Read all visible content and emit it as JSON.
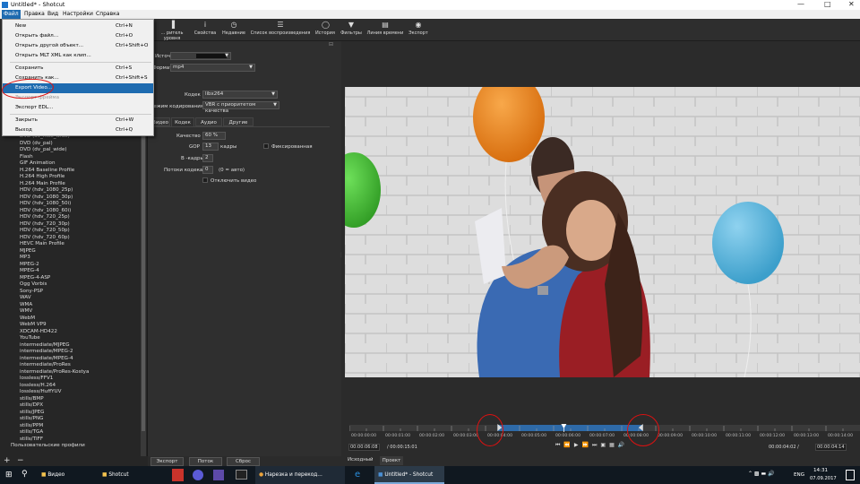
{
  "window": {
    "title": "Untitled* - Shotcut"
  },
  "menubar": [
    "Файл",
    "Правка",
    "Вид",
    "Настройки",
    "Справка"
  ],
  "toolbar": [
    {
      "label": "... ритель уровня",
      "icon": "meter-icon"
    },
    {
      "label": "Свойства",
      "icon": "info-icon"
    },
    {
      "label": "Недавние",
      "icon": "clock-icon"
    },
    {
      "label": "Список воспроизведения",
      "icon": "list-icon"
    },
    {
      "label": "История",
      "icon": "history-icon"
    },
    {
      "label": "Фильтры",
      "icon": "filter-icon"
    },
    {
      "label": "Линия времени",
      "icon": "timeline-icon"
    },
    {
      "label": "Экспорт",
      "icon": "export-icon"
    }
  ],
  "file_menu": {
    "items": [
      {
        "label": "New",
        "shortcut": "Ctrl+N"
      },
      {
        "label": "Открыть файл...",
        "shortcut": "Ctrl+O"
      },
      {
        "label": "Открыть другой объект...",
        "shortcut": "Ctrl+Shift+O"
      },
      {
        "label": "Открыть MLT XML как клип...",
        "shortcut": ""
      },
      {
        "label": "Сохранить",
        "shortcut": "Ctrl+S"
      },
      {
        "label": "Сохранить как...",
        "shortcut": "Ctrl+Shift+S"
      },
      {
        "label": "Export Video...",
        "shortcut": ""
      },
      {
        "label": "Экспорт фрейма",
        "shortcut": ""
      },
      {
        "label": "Экспорт EDL...",
        "shortcut": ""
      },
      {
        "label": "Закрыть",
        "shortcut": "Ctrl+W"
      },
      {
        "label": "Выход",
        "shortcut": "Ctrl+Q"
      }
    ]
  },
  "export": {
    "source_label": "Источник",
    "format_label": "Формат",
    "format_value": "mp4",
    "tabs": [
      "Видео",
      "Кодек",
      "Аудио",
      "Другие"
    ],
    "codec_label": "Кодек",
    "codec_value": "libx264",
    "ratecontrol_label": "Режим кодирования",
    "ratecontrol_value": "VBR с приоритетом качества",
    "quality_label": "Качество",
    "quality_value": "60 %",
    "gop_label": "GOP",
    "gop_value": "13",
    "gop_unit": "кадры",
    "fixed_label": "Фиксированная",
    "bframes_label": "B -кадры",
    "bframes_value": "2",
    "threads_label": "Потоки кодека",
    "threads_value": "0",
    "threads_hint": "(0 = авто)",
    "disable_video_label": "Отключить видео",
    "buttons": [
      "Экспорт",
      "Поток",
      "Сброс"
    ]
  },
  "presets": [
    {
      "label": "DVD (dv_ntsc_wide)",
      "indent": true
    },
    {
      "label": "DVD (dv_pal)",
      "indent": true
    },
    {
      "label": "DVD (dv_pal_wide)",
      "indent": true
    },
    {
      "label": "Flash",
      "indent": true
    },
    {
      "label": "GIF Animation",
      "indent": true
    },
    {
      "label": "H.264 Baseline Profile",
      "indent": true
    },
    {
      "label": "H.264 High Profile",
      "indent": true
    },
    {
      "label": "H.264 Main Profile",
      "indent": true
    },
    {
      "label": "HDV (hdv_1080_25p)",
      "indent": true
    },
    {
      "label": "HDV (hdv_1080_30p)",
      "indent": true
    },
    {
      "label": "HDV (hdv_1080_50i)",
      "indent": true
    },
    {
      "label": "HDV (hdv_1080_60i)",
      "indent": true
    },
    {
      "label": "HDV (hdv_720_25p)",
      "indent": true
    },
    {
      "label": "HDV (hdv_720_30p)",
      "indent": true
    },
    {
      "label": "HDV (hdv_720_50p)",
      "indent": true
    },
    {
      "label": "HDV (hdv_720_60p)",
      "indent": true
    },
    {
      "label": "HEVC Main Profile",
      "indent": true
    },
    {
      "label": "MJPEG",
      "indent": true
    },
    {
      "label": "MP3",
      "indent": true
    },
    {
      "label": "MPEG-2",
      "indent": true
    },
    {
      "label": "MPEG-4",
      "indent": true
    },
    {
      "label": "MPEG-4-ASP",
      "indent": true
    },
    {
      "label": "Ogg Vorbis",
      "indent": true
    },
    {
      "label": "Sony-PSP",
      "indent": true
    },
    {
      "label": "WAV",
      "indent": true
    },
    {
      "label": "WMA",
      "indent": true
    },
    {
      "label": "WMV",
      "indent": true
    },
    {
      "label": "WebM",
      "indent": true
    },
    {
      "label": "WebM VP9",
      "indent": true
    },
    {
      "label": "XDCAM-HD422",
      "indent": true
    },
    {
      "label": "YouTube",
      "indent": true
    },
    {
      "label": "intermediate/MJPEG",
      "indent": true
    },
    {
      "label": "intermediate/MPEG-2",
      "indent": true
    },
    {
      "label": "intermediate/MPEG-4",
      "indent": true
    },
    {
      "label": "intermediate/ProRes",
      "indent": true
    },
    {
      "label": "intermediate/ProRes-Kostya",
      "indent": true
    },
    {
      "label": "lossless/FFV1",
      "indent": true
    },
    {
      "label": "lossless/H.264",
      "indent": true
    },
    {
      "label": "lossless/HuffYUV",
      "indent": true
    },
    {
      "label": "stills/BMP",
      "indent": true
    },
    {
      "label": "stills/DPX",
      "indent": true
    },
    {
      "label": "stills/JPEG",
      "indent": true
    },
    {
      "label": "stills/PNG",
      "indent": true
    },
    {
      "label": "stills/PPM",
      "indent": true
    },
    {
      "label": "stills/TGA",
      "indent": true
    },
    {
      "label": "stills/TIFF",
      "indent": true
    },
    {
      "label": "Пользовательские профили",
      "indent": false
    }
  ],
  "player": {
    "ticks": [
      "00:00:00:00",
      "00:00:01:00",
      "00:00:02:00",
      "00:00:03:00",
      "00:00:04:00",
      "00:00:05:00",
      "00:00:06:00",
      "00:00:07:00",
      "00:00:08:00",
      "00:00:09:00",
      "00:00:10:00",
      "00:00:11:00",
      "00:00:12:00",
      "00:00:13:00",
      "00:00:14:00"
    ],
    "position": "00:00:06:08",
    "duration": "/ 00:00:15:01",
    "in_out_duration": "00:00:04:02 /",
    "out_point": "00:00:04:14",
    "tabs": [
      "Исходный",
      "Проект"
    ],
    "selection_start": 0.29,
    "selection_end": 0.575,
    "playhead": 0.42
  },
  "taskbar": {
    "items": [
      "Видео",
      "Shotcut",
      "Нарезка и перекод...",
      "Untitled* - Shotcut"
    ],
    "lang": "ENG",
    "time": "14:31",
    "date": "07.09.2017"
  },
  "colors": {
    "accent": "#1e6bb0",
    "annotation": "#d11111",
    "selection": "#2e6aa8"
  }
}
